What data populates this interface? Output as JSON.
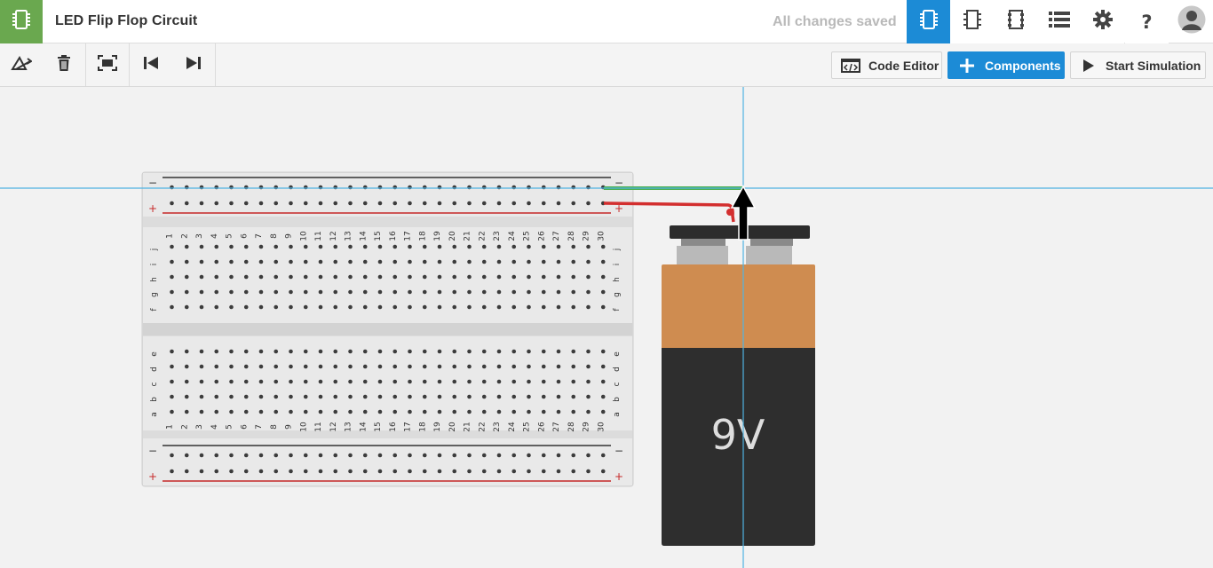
{
  "app": {
    "title": "LED Flip Flop Circuit",
    "save_status": "All changes saved"
  },
  "topbar": {
    "views": [
      {
        "name": "circuit-view-icon",
        "active": true
      },
      {
        "name": "schematic-view-icon",
        "active": false
      },
      {
        "name": "pcb-view-icon",
        "active": false
      },
      {
        "name": "component-list-icon",
        "active": false
      },
      {
        "name": "settings-icon",
        "active": false
      }
    ],
    "help_label": "?",
    "avatar_icon": "user-avatar-icon"
  },
  "toolbar": {
    "tools": [
      "rotate-icon",
      "delete-icon",
      "fit-view-icon",
      "undo-icon",
      "redo-icon"
    ],
    "code_editor_label": "Code Editor",
    "components_label": "Components",
    "start_simulation_label": "Start Simulation"
  },
  "breadboard": {
    "columns": [
      "1",
      "2",
      "3",
      "4",
      "5",
      "6",
      "7",
      "8",
      "9",
      "10",
      "11",
      "12",
      "13",
      "14",
      "15",
      "16",
      "17",
      "18",
      "19",
      "20",
      "21",
      "22",
      "23",
      "24",
      "25",
      "26",
      "27",
      "28",
      "29",
      "30"
    ],
    "upper_rows": [
      "j",
      "i",
      "h",
      "g",
      "f"
    ],
    "lower_rows": [
      "e",
      "d",
      "c",
      "b",
      "a"
    ],
    "minus_label": "−",
    "plus_label": "+"
  },
  "battery": {
    "label": "9V"
  },
  "colors": {
    "accent": "#1c8bd6",
    "brand": "#6aa84f",
    "wire_green": "#4caf50",
    "wire_red": "#d32f2f",
    "guide_line": "#4fb3e3",
    "battery_top": "#cf8c50",
    "battery_body": "#2e2e2e"
  }
}
